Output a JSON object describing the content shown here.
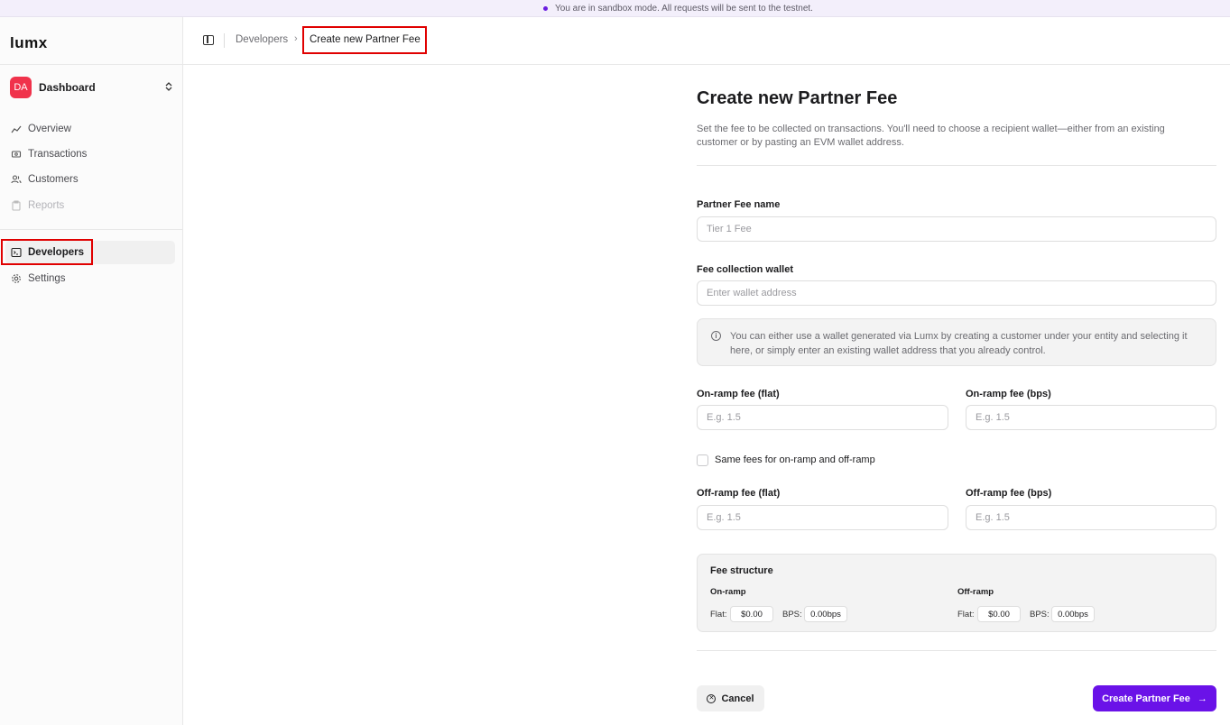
{
  "banner": {
    "text": "You are in sandbox mode. All requests will be sent to the testnet."
  },
  "sidebar": {
    "logo": "lumx",
    "org": {
      "initials": "DA",
      "name": "Dashboard"
    },
    "items": [
      {
        "label": "Overview",
        "icon": "chart-icon"
      },
      {
        "label": "Transactions",
        "icon": "transactions-icon"
      },
      {
        "label": "Customers",
        "icon": "users-icon"
      },
      {
        "label": "Reports",
        "icon": "clipboard-icon",
        "disabled": true
      },
      {
        "label": "Developers",
        "icon": "terminal-icon",
        "active": true
      },
      {
        "label": "Settings",
        "icon": "gear-icon"
      }
    ]
  },
  "header": {
    "breadcrumb": [
      "Developers",
      "Create new Partner Fee"
    ]
  },
  "form": {
    "title": "Create new Partner Fee",
    "description": "Set the fee to be collected on transactions. You'll need to choose a recipient wallet—either from an existing customer or by pasting an EVM wallet address.",
    "name_label": "Partner Fee name",
    "name_placeholder": "Tier 1 Fee",
    "wallet_label": "Fee collection wallet",
    "wallet_placeholder": "Enter wallet address",
    "info_text": "You can either use a wallet generated via Lumx by creating a customer under your entity and selecting it here, or simply enter an existing wallet address that you already control.",
    "onramp_flat_label": "On-ramp fee (flat)",
    "onramp_bps_label": "On-ramp fee (bps)",
    "same_fees_label": "Same fees for on-ramp and off-ramp",
    "offramp_flat_label": "Off-ramp fee (flat)",
    "offramp_bps_label": "Off-ramp fee (bps)",
    "fee_placeholder": "E.g. 1.5",
    "fee_structure": {
      "title": "Fee structure",
      "onramp": {
        "title": "On-ramp",
        "flat_key": "Flat:",
        "flat": "$0.00",
        "bps_key": "BPS:",
        "bps": "0.00bps"
      },
      "offramp": {
        "title": "Off-ramp",
        "flat_key": "Flat:",
        "flat": "$0.00",
        "bps_key": "BPS:",
        "bps": "0.00bps"
      }
    },
    "cancel_label": "Cancel",
    "create_label": "Create Partner Fee"
  },
  "colors": {
    "accent": "#6a12e8",
    "highlight": "#e00000",
    "avatar": "#f0324b"
  }
}
